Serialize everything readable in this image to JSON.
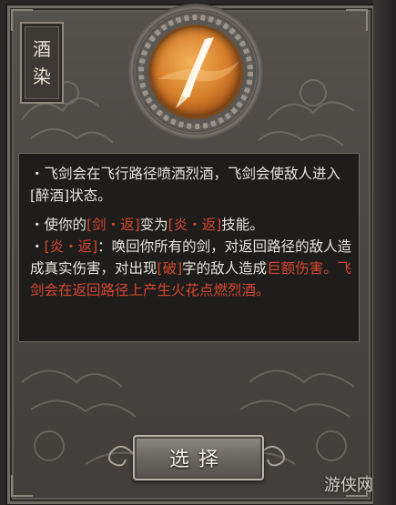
{
  "card": {
    "title_chars": [
      "酒",
      "染"
    ],
    "icon": "flying-sword-icon",
    "accent_color": "#e08a34",
    "highlight_color": "#d8462e",
    "text_color": "#e9e6e0"
  },
  "description": {
    "p1": {
      "text1": "・飞剑会在飞行路径喷洒烈酒，飞剑会使敌人进入",
      "status": "[醉酒]",
      "text2": "状态。"
    },
    "p2": {
      "text1": "・使你的",
      "skill_a": "[剑・返]",
      "text2": "变为",
      "skill_b": "[炎・返]",
      "text3": "技能。"
    },
    "p3": {
      "skill": "[炎・返]",
      "text1": "：唤回你所有的剑，对返回路径的敌人造成真实伤害，对出现",
      "mark": "[破]",
      "text2": "字的敌人造成",
      "red": "巨额伤害。飞剑会在返回路径上产生火花点燃烈酒。"
    }
  },
  "button": {
    "label": "选择"
  },
  "watermark": {
    "text": "游侠网"
  }
}
